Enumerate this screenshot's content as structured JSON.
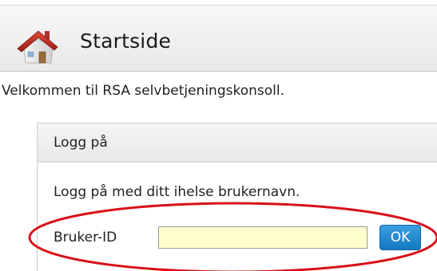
{
  "header": {
    "title": "Startside",
    "icon": "home-icon"
  },
  "welcome_text": "Velkommen til RSA selvbetjeningskonsoll.",
  "login_panel": {
    "title": "Logg på",
    "instruction": "Logg på med ditt ihelse brukernavn.",
    "userid_label": "Bruker-ID",
    "userid_value": "",
    "ok_label": "OK"
  },
  "colors": {
    "ok_button": "#1a7fc8",
    "input_background": "#ffffcc",
    "highlight": "#d8101a"
  }
}
